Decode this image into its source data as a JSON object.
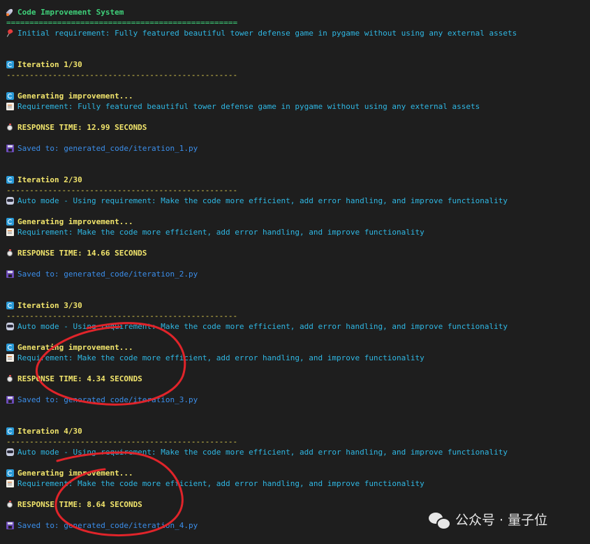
{
  "header": {
    "title": "Code Improvement System",
    "separator": "==================================================",
    "initial_requirement_label": "Initial requirement: Fully featured beautiful tower defense game in pygame without using any external assets"
  },
  "dash_separator": "--------------------------------------------------",
  "iterations": [
    {
      "title": "Iteration 1/30",
      "generating": "Generating improvement...",
      "requirement": "Requirement: Fully featured beautiful tower defense game in pygame without using any external assets",
      "response_time": "RESPONSE TIME: 12.99 SECONDS",
      "saved": "Saved to: generated_code/iteration_1.py"
    },
    {
      "title": "Iteration 2/30",
      "auto_mode": "Auto mode - Using requirement: Make the code more efficient, add error handling, and improve functionality",
      "generating": "Generating improvement...",
      "requirement": "Requirement: Make the code more efficient, add error handling, and improve functionality",
      "response_time": "RESPONSE TIME: 14.66 SECONDS",
      "saved": "Saved to: generated_code/iteration_2.py"
    },
    {
      "title": "Iteration 3/30",
      "auto_mode": "Auto mode - Using requirement: Make the code more efficient, add error handling, and improve functionality",
      "generating": "Generating improvement...",
      "requirement": "Requirement: Make the code more efficient, add error handling, and improve functionality",
      "response_time": "RESPONSE TIME: 4.34 SECONDS",
      "saved": "Saved to: generated_code/iteration_3.py"
    },
    {
      "title": "Iteration 4/30",
      "auto_mode": "Auto mode - Using requirement: Make the code more efficient, add error handling, and improve functionality",
      "generating": "Generating improvement...",
      "requirement": "Requirement: Make the code more efficient, add error handling, and improve functionality",
      "response_time": "RESPONSE TIME: 8.64 SECONDS",
      "saved": "Saved to: generated_code/iteration_4.py"
    }
  ],
  "watermark": {
    "text": "公众号 · 量子位"
  },
  "colors": {
    "background": "#1e1e1e",
    "green": "#3fd17a",
    "cyan": "#2fb7e3",
    "yellow": "#f2e56c",
    "blue": "#3b8eea",
    "annotation_red": "#e0242a"
  }
}
